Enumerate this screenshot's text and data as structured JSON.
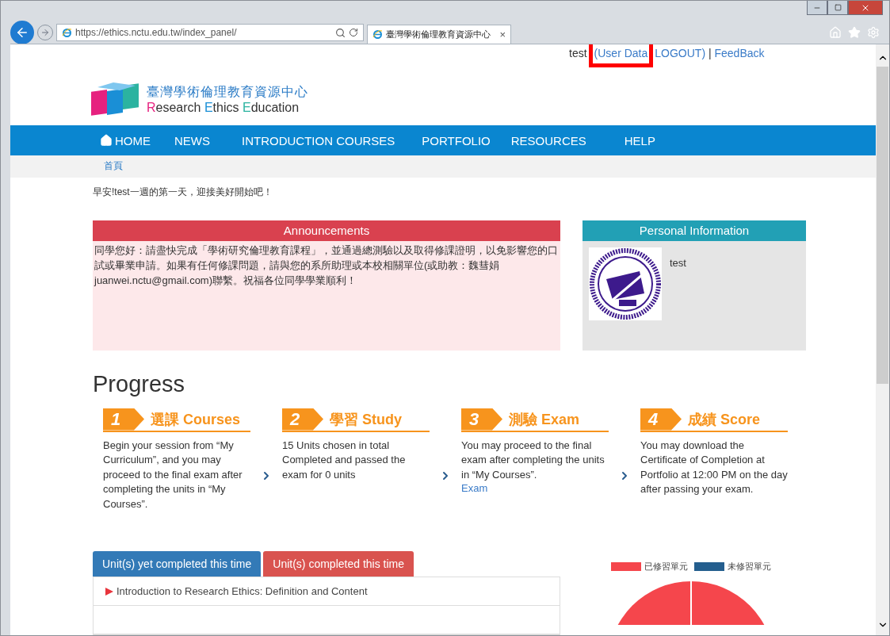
{
  "browser": {
    "url": "https://ethics.nctu.edu.tw/index_panel/",
    "tab_title": "臺灣學術倫理教育資源中心",
    "tab_close": "×"
  },
  "top_links": {
    "user": "test",
    "links": [
      {
        "label": "(User Data",
        "highlighted": true
      },
      {
        "label": "LOGOUT)",
        "highlighted": false
      },
      {
        "label": "FeedBack",
        "highlighted": false
      }
    ],
    "separator": "|"
  },
  "logo": {
    "title": "臺灣學術倫理教育資源中心",
    "subtitle_parts": [
      {
        "text": "R",
        "color": "#e6217f"
      },
      {
        "text": "esearch ",
        "color": "#333333"
      },
      {
        "text": "E",
        "color": "#1a8fd6"
      },
      {
        "text": "thics ",
        "color": "#333333"
      },
      {
        "text": "E",
        "color": "#2bb3a0"
      },
      {
        "text": "ducation",
        "color": "#333333"
      }
    ]
  },
  "nav": [
    {
      "label": "HOME",
      "kind": "home"
    },
    {
      "label": "NEWS",
      "kind": "plain"
    },
    {
      "label": "INTRODUCTION COURSES",
      "kind": "plain"
    },
    {
      "label": "PORTFOLIO",
      "kind": "plain"
    },
    {
      "label": "RESOURCES",
      "kind": "plain"
    },
    {
      "label": "HELP",
      "kind": "plain"
    }
  ],
  "breadcrumb": [
    "首頁"
  ],
  "greeting": "早安!test一週的第一天，迎接美好開始吧！",
  "announcements": {
    "title": "Announcements",
    "body": "同學您好：請盡快完成「學術研究倫理教育課程」，並通過總測驗以及取得修課證明，以免影響您的口試或畢業申請。如果有任何修課問題，請與您的系所助理或本校相關單位(或助教：魏彗娟 juanwei.nctu@gmail.com)聯繫。祝福各位同學學業順利！"
  },
  "personal": {
    "title": "Personal Information",
    "name": "test"
  },
  "progress": {
    "title": "Progress",
    "steps": [
      {
        "number": "1",
        "title": "選課 Courses",
        "text": "Begin your session from “My Curriculum”, and you may proceed to the final exam after completing the units in “My Courses”."
      },
      {
        "number": "2",
        "title": "學習 Study",
        "text": "15 Units chosen in total Completed and passed the exam for 0 units"
      },
      {
        "number": "3",
        "title": "測驗 Exam",
        "text": "You may proceed to the final exam after completing the units in “My Courses”.",
        "link": "Exam"
      },
      {
        "number": "4",
        "title": "成績 Score",
        "text": "You may download the Certificate of Completion at Portfolio at 12:00 PM on the day after passing your exam."
      }
    ]
  },
  "unit_tabs": [
    {
      "label": "Unit(s) yet completed this time",
      "kind": "primary"
    },
    {
      "label": "Unit(s) completed this time",
      "kind": "danger"
    }
  ],
  "units": [
    "Introduction to Research Ethics: Definition and Content"
  ],
  "chart_legend": [
    {
      "label": "已修習單元",
      "color": "#f5464c"
    },
    {
      "label": "未修習單元",
      "color": "#245e8e"
    }
  ]
}
